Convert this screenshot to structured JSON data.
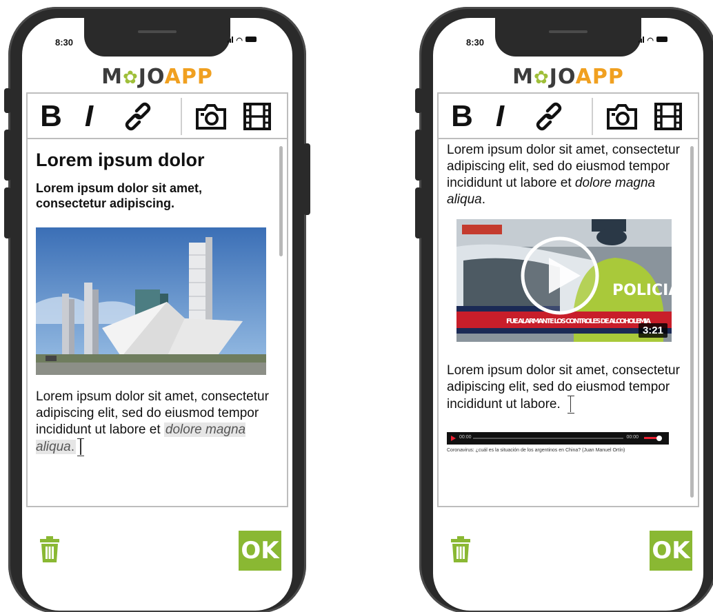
{
  "status": {
    "time": "8:30"
  },
  "logo": {
    "left": "M",
    "mid": "JO",
    "right": "APP"
  },
  "colors": {
    "brand_green": "#8ab833",
    "brand_orange": "#f0a020",
    "logo_dark": "#3c3c3c"
  },
  "toolbar": {
    "bold_label": "B",
    "italic_label": "I",
    "icons": [
      "link-icon",
      "camera-icon",
      "film-icon"
    ]
  },
  "left_screen": {
    "heading": "Lorem ipsum dolor",
    "subheading": "Lorem ipsum dolor sit amet, consectetur adipiscing.",
    "paragraph_plain": "Lorem ipsum dolor sit amet, consectetur adipiscing elit, sed do eiusmod tempor incididunt ut labore et ",
    "paragraph_selected": "dolore magna aliqua",
    "paragraph_end": "."
  },
  "right_screen": {
    "paragraph1_plain": "Lorem ipsum dolor sit amet, consectetur adipiscing elit, sed do eiusmod tempor incididunt ut labore et ",
    "paragraph1_italic": "dolore magna aliqua",
    "paragraph1_end": ".",
    "video_duration": "3:21",
    "video_banner": "FUE ALARMANTE LOS CONTROLES DE ALCOHOLEMIA",
    "video_vest_label": "POLICIA",
    "paragraph2": "Lorem ipsum dolor sit amet, consectetur adipiscing elit, sed do eiusmod tempor incididunt ut labore.",
    "audio_current": "00:00",
    "audio_total": "00:00",
    "audio_caption": "Coronavirus: ¿cuál es la situación de los argentinos en China? (Juan Manuel Ortín)"
  },
  "actions": {
    "ok_label": "OK"
  }
}
